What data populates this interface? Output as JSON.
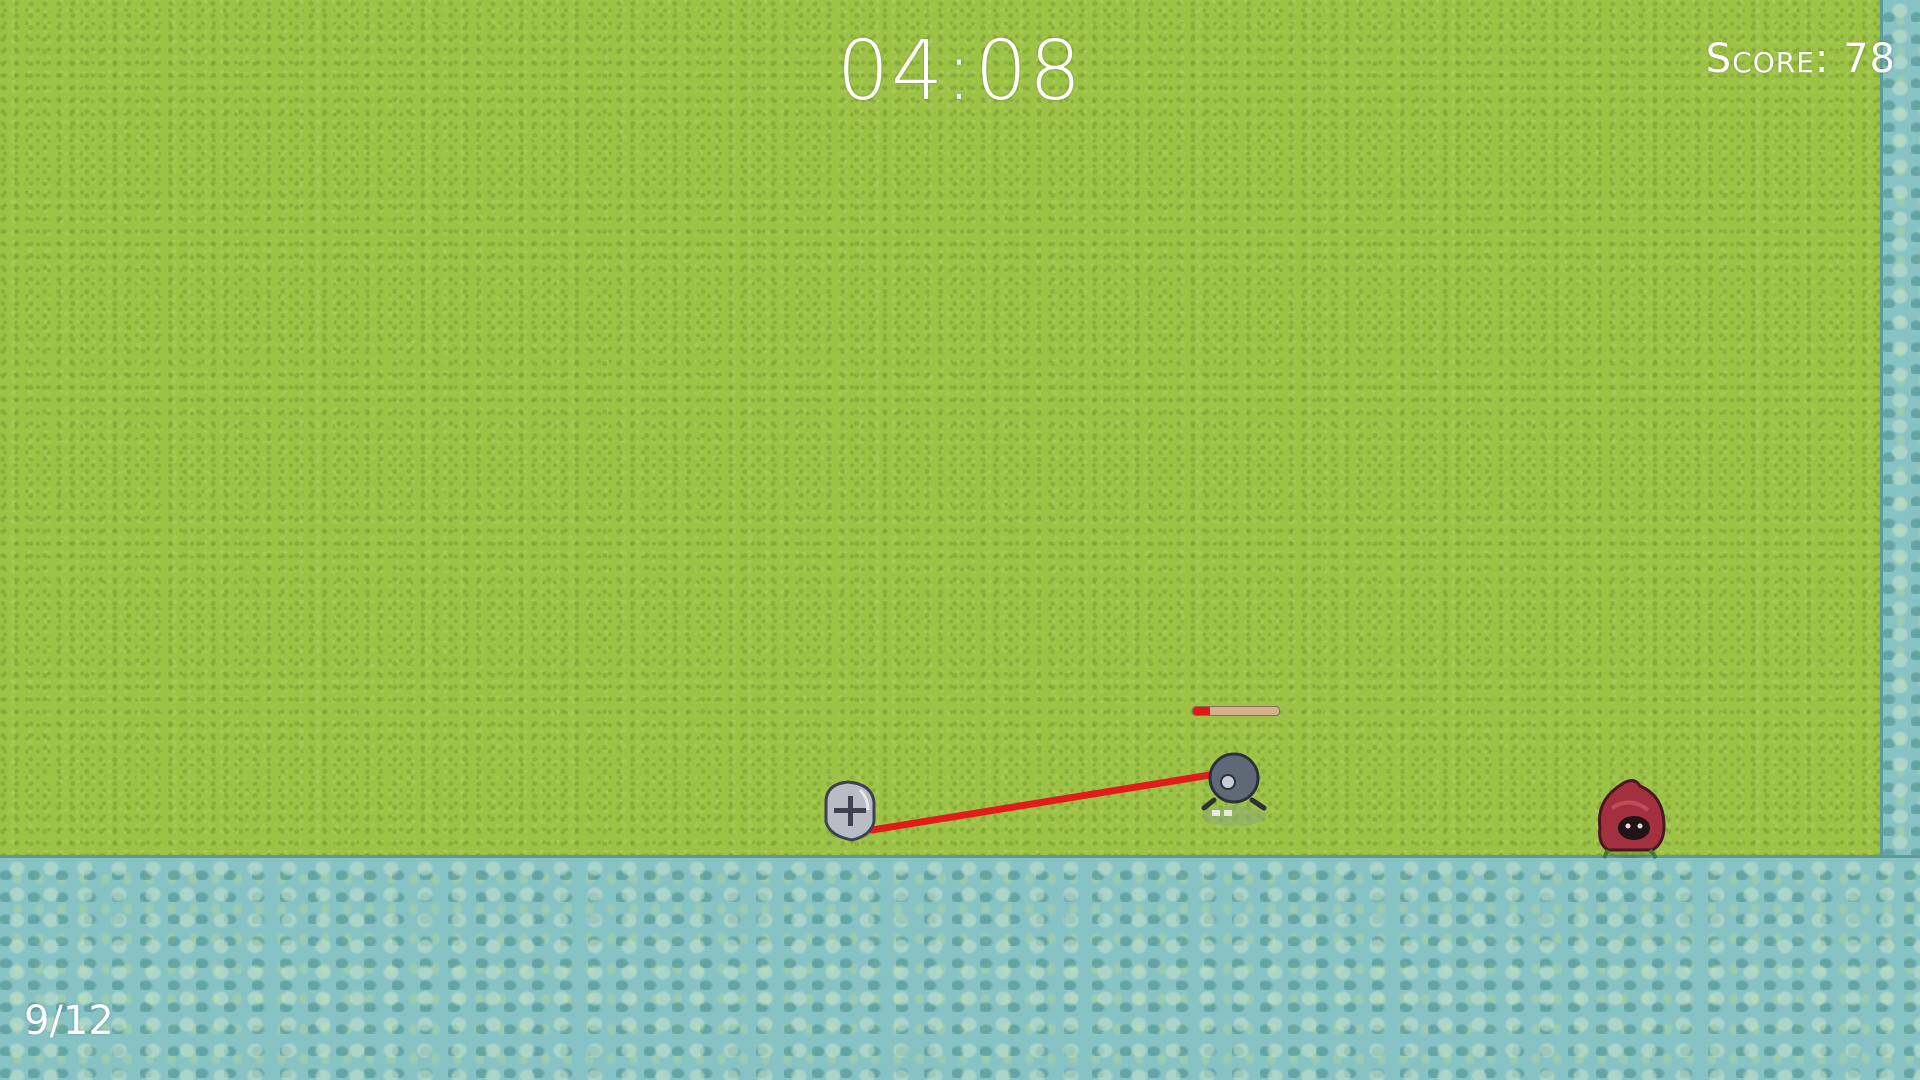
{
  "hud": {
    "timer": "04:08",
    "score_label": "Score: 78",
    "wave_counter": "9/12"
  },
  "enemy": {
    "health_fraction": 0.2
  },
  "colors": {
    "grass": "#9cc246",
    "water": "#87c2c4",
    "laser": "#e41b1b",
    "health_fill": "#e01818",
    "hud_text": "#ffffff"
  },
  "icons": {
    "player": "knight-helmet-icon",
    "enemy_target": "gray-blob-enemy-icon",
    "enemy_hooded": "red-hooded-enemy-icon"
  }
}
